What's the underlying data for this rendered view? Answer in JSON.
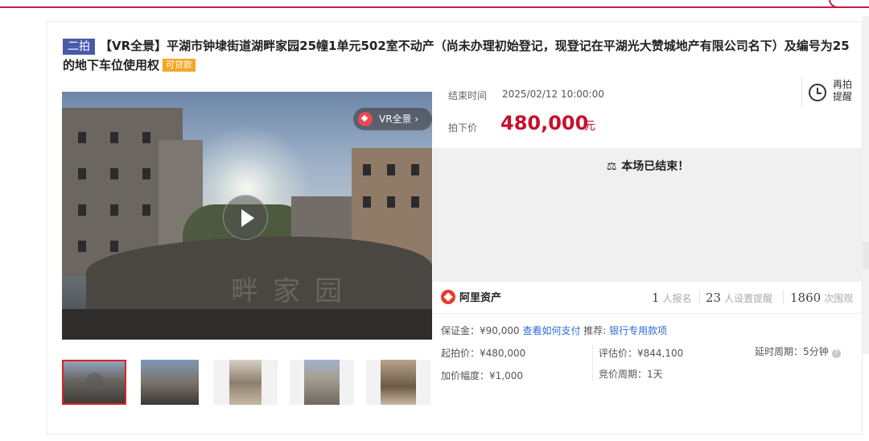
{
  "header": {
    "round_tag": "二拍",
    "title": "【VR全景】平湖市钟埭街道湖畔家园25幢1单元502室不动产（尚未办理初始登记，现登记在平湖光大赞城地产有限公司名下）及编号为25的地下车位使用权",
    "loan_tag": "可贷款"
  },
  "media": {
    "vr_label": "VR全景 ›",
    "rock_text": "畔家园",
    "thumbnails": [
      "thumb-1",
      "thumb-2",
      "thumb-3",
      "thumb-4",
      "thumb-5"
    ]
  },
  "auction": {
    "end_time_label": "结束时间",
    "end_time_value": "2025/02/12 10:00:00",
    "final_price_label": "拍下价",
    "final_price_value": "480,000",
    "final_price_unit": "元",
    "remind_label": "再拍提醒",
    "status_text": "本场已结束！"
  },
  "platform": {
    "name": "阿里资产"
  },
  "stats": {
    "signups_count": "1",
    "signups_label": "人报名",
    "reminders_count": "23",
    "reminders_label": "人设置提醒",
    "views_count": "1860",
    "views_label": "次围观"
  },
  "details": {
    "deposit": "保证金：¥90,000",
    "deposit_link": "查看如何支付",
    "recommend_label": "推荐:",
    "recommend_link": "银行专用款项",
    "start_price": "起拍价：¥480,000",
    "appraisal": "评估价：¥844,100",
    "delay_period": "延时周期：5分钟",
    "increment": "加价幅度：¥1,000",
    "bid_period": "竞价周期：1天"
  },
  "colors": {
    "accent": "#c8102e",
    "link": "#2b6bd8",
    "round_tag_bg": "#4a5aa8",
    "loan_tag_bg": "#f5a623"
  }
}
